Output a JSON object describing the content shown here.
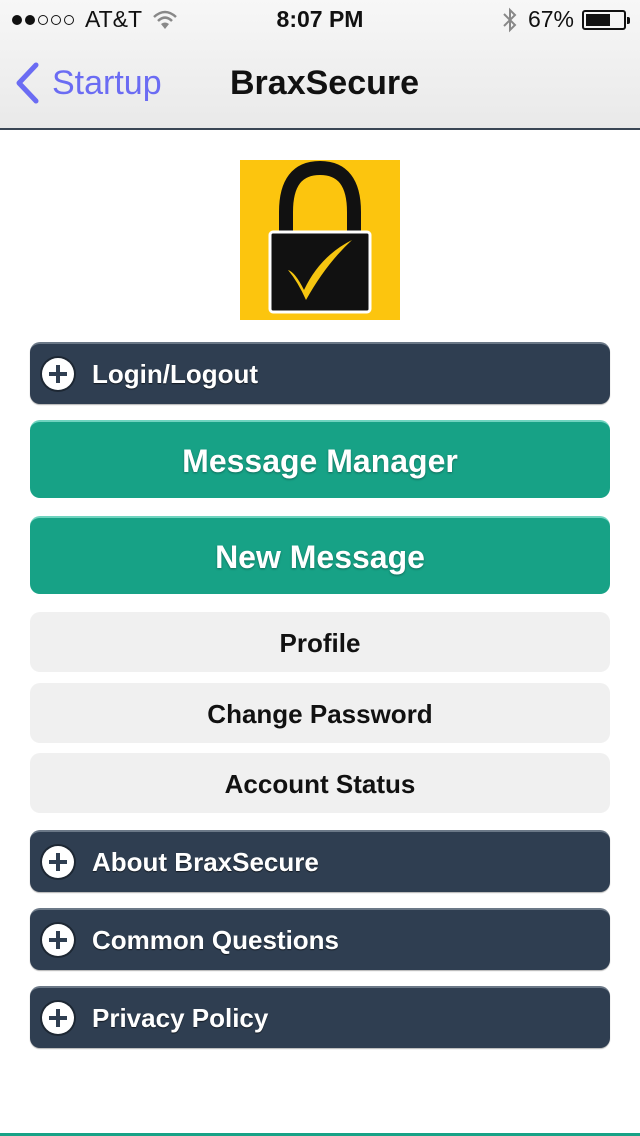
{
  "status_bar": {
    "carrier": "AT&T",
    "time": "8:07 PM",
    "battery": "67%",
    "battery_level": 0.67,
    "signal_bars_filled": 2,
    "signal_bars_total": 5
  },
  "nav": {
    "back_label": "Startup",
    "title": "BraxSecure"
  },
  "logo": {
    "icon": "padlock-checkmark-icon",
    "background": "#fcc50e"
  },
  "menu": {
    "login": "Login/Logout",
    "message_manager": "Message Manager",
    "new_message": "New Message",
    "profile": "Profile",
    "change_password": "Change Password",
    "account_status": "Account Status",
    "about": "About BraxSecure",
    "common_questions": "Common Questions",
    "privacy_policy": "Privacy Policy"
  },
  "colors": {
    "accent_green": "#17a286",
    "dark_button": "#2f3e51",
    "back_link": "#6b6cf3"
  }
}
